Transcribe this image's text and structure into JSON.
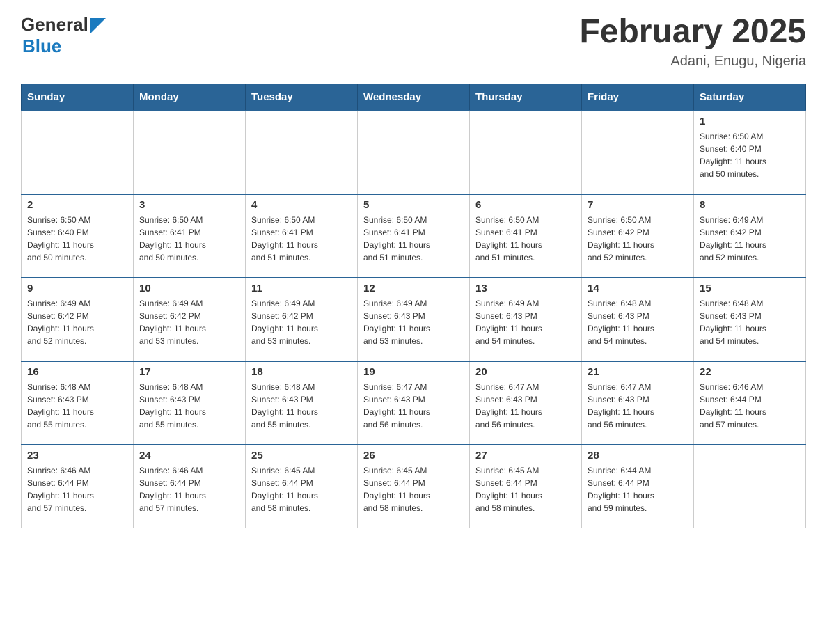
{
  "header": {
    "logo_general": "General",
    "logo_blue": "Blue",
    "title": "February 2025",
    "subtitle": "Adani, Enugu, Nigeria"
  },
  "weekdays": [
    "Sunday",
    "Monday",
    "Tuesday",
    "Wednesday",
    "Thursday",
    "Friday",
    "Saturday"
  ],
  "weeks": [
    [
      {
        "day": "",
        "info": ""
      },
      {
        "day": "",
        "info": ""
      },
      {
        "day": "",
        "info": ""
      },
      {
        "day": "",
        "info": ""
      },
      {
        "day": "",
        "info": ""
      },
      {
        "day": "",
        "info": ""
      },
      {
        "day": "1",
        "info": "Sunrise: 6:50 AM\nSunset: 6:40 PM\nDaylight: 11 hours\nand 50 minutes."
      }
    ],
    [
      {
        "day": "2",
        "info": "Sunrise: 6:50 AM\nSunset: 6:40 PM\nDaylight: 11 hours\nand 50 minutes."
      },
      {
        "day": "3",
        "info": "Sunrise: 6:50 AM\nSunset: 6:41 PM\nDaylight: 11 hours\nand 50 minutes."
      },
      {
        "day": "4",
        "info": "Sunrise: 6:50 AM\nSunset: 6:41 PM\nDaylight: 11 hours\nand 51 minutes."
      },
      {
        "day": "5",
        "info": "Sunrise: 6:50 AM\nSunset: 6:41 PM\nDaylight: 11 hours\nand 51 minutes."
      },
      {
        "day": "6",
        "info": "Sunrise: 6:50 AM\nSunset: 6:41 PM\nDaylight: 11 hours\nand 51 minutes."
      },
      {
        "day": "7",
        "info": "Sunrise: 6:50 AM\nSunset: 6:42 PM\nDaylight: 11 hours\nand 52 minutes."
      },
      {
        "day": "8",
        "info": "Sunrise: 6:49 AM\nSunset: 6:42 PM\nDaylight: 11 hours\nand 52 minutes."
      }
    ],
    [
      {
        "day": "9",
        "info": "Sunrise: 6:49 AM\nSunset: 6:42 PM\nDaylight: 11 hours\nand 52 minutes."
      },
      {
        "day": "10",
        "info": "Sunrise: 6:49 AM\nSunset: 6:42 PM\nDaylight: 11 hours\nand 53 minutes."
      },
      {
        "day": "11",
        "info": "Sunrise: 6:49 AM\nSunset: 6:42 PM\nDaylight: 11 hours\nand 53 minutes."
      },
      {
        "day": "12",
        "info": "Sunrise: 6:49 AM\nSunset: 6:43 PM\nDaylight: 11 hours\nand 53 minutes."
      },
      {
        "day": "13",
        "info": "Sunrise: 6:49 AM\nSunset: 6:43 PM\nDaylight: 11 hours\nand 54 minutes."
      },
      {
        "day": "14",
        "info": "Sunrise: 6:48 AM\nSunset: 6:43 PM\nDaylight: 11 hours\nand 54 minutes."
      },
      {
        "day": "15",
        "info": "Sunrise: 6:48 AM\nSunset: 6:43 PM\nDaylight: 11 hours\nand 54 minutes."
      }
    ],
    [
      {
        "day": "16",
        "info": "Sunrise: 6:48 AM\nSunset: 6:43 PM\nDaylight: 11 hours\nand 55 minutes."
      },
      {
        "day": "17",
        "info": "Sunrise: 6:48 AM\nSunset: 6:43 PM\nDaylight: 11 hours\nand 55 minutes."
      },
      {
        "day": "18",
        "info": "Sunrise: 6:48 AM\nSunset: 6:43 PM\nDaylight: 11 hours\nand 55 minutes."
      },
      {
        "day": "19",
        "info": "Sunrise: 6:47 AM\nSunset: 6:43 PM\nDaylight: 11 hours\nand 56 minutes."
      },
      {
        "day": "20",
        "info": "Sunrise: 6:47 AM\nSunset: 6:43 PM\nDaylight: 11 hours\nand 56 minutes."
      },
      {
        "day": "21",
        "info": "Sunrise: 6:47 AM\nSunset: 6:43 PM\nDaylight: 11 hours\nand 56 minutes."
      },
      {
        "day": "22",
        "info": "Sunrise: 6:46 AM\nSunset: 6:44 PM\nDaylight: 11 hours\nand 57 minutes."
      }
    ],
    [
      {
        "day": "23",
        "info": "Sunrise: 6:46 AM\nSunset: 6:44 PM\nDaylight: 11 hours\nand 57 minutes."
      },
      {
        "day": "24",
        "info": "Sunrise: 6:46 AM\nSunset: 6:44 PM\nDaylight: 11 hours\nand 57 minutes."
      },
      {
        "day": "25",
        "info": "Sunrise: 6:45 AM\nSunset: 6:44 PM\nDaylight: 11 hours\nand 58 minutes."
      },
      {
        "day": "26",
        "info": "Sunrise: 6:45 AM\nSunset: 6:44 PM\nDaylight: 11 hours\nand 58 minutes."
      },
      {
        "day": "27",
        "info": "Sunrise: 6:45 AM\nSunset: 6:44 PM\nDaylight: 11 hours\nand 58 minutes."
      },
      {
        "day": "28",
        "info": "Sunrise: 6:44 AM\nSunset: 6:44 PM\nDaylight: 11 hours\nand 59 minutes."
      },
      {
        "day": "",
        "info": ""
      }
    ]
  ]
}
